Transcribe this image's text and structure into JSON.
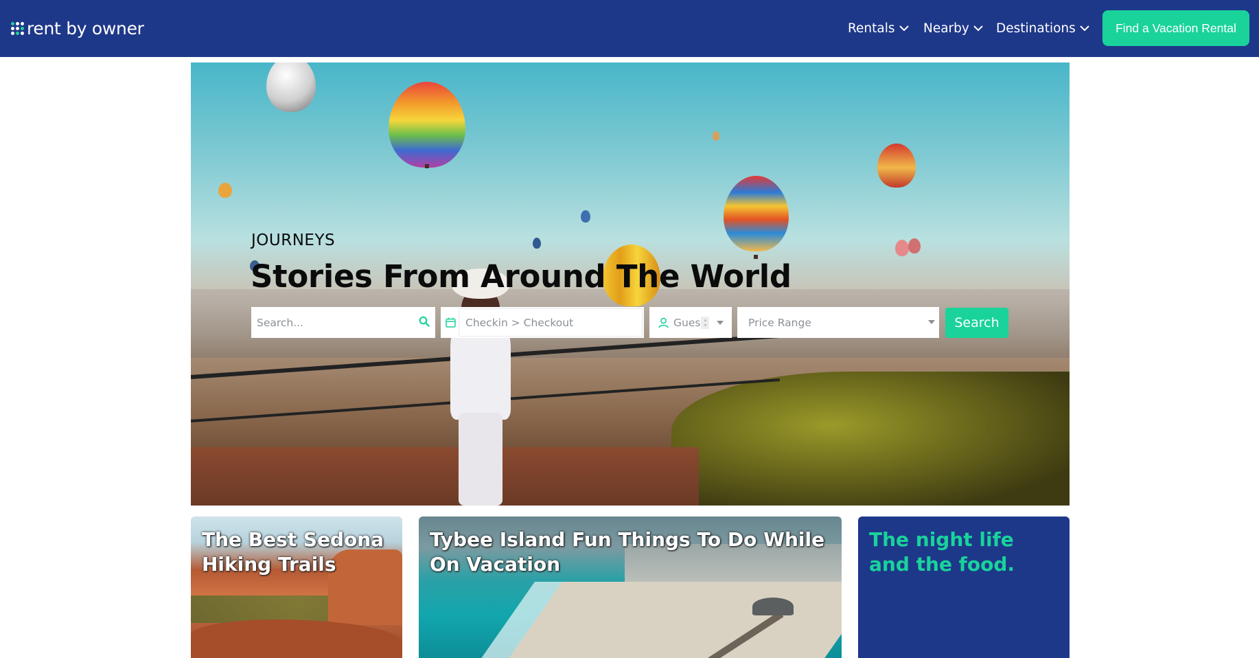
{
  "brand": {
    "logo_text": "rent by owner"
  },
  "nav": {
    "items": [
      {
        "label": "Rentals"
      },
      {
        "label": "Nearby"
      },
      {
        "label": "Destinations"
      }
    ],
    "cta_label": "Find a Vacation Rental"
  },
  "hero": {
    "eyebrow": "JOURNEYS",
    "title": "Stories From Around The World"
  },
  "search": {
    "keyword_placeholder": "Search...",
    "dates_placeholder": "Checkin > Checkout",
    "guests_label": "Gues",
    "price_placeholder": "Price Range",
    "button_label": "Search"
  },
  "cards": [
    {
      "title": "The Best Sedona Hiking Trails"
    },
    {
      "title": "Tybee Island Fun Things To Do While On Vacation"
    },
    {
      "title": "The night life and the food."
    }
  ],
  "colors": {
    "navy": "#1e3889",
    "accent_green": "#19d39b",
    "white": "#ffffff"
  },
  "icons": [
    "logo-dots-icon",
    "chevron-down-icon",
    "search-icon",
    "calendar-icon",
    "guests-icon",
    "caret-down-icon"
  ]
}
